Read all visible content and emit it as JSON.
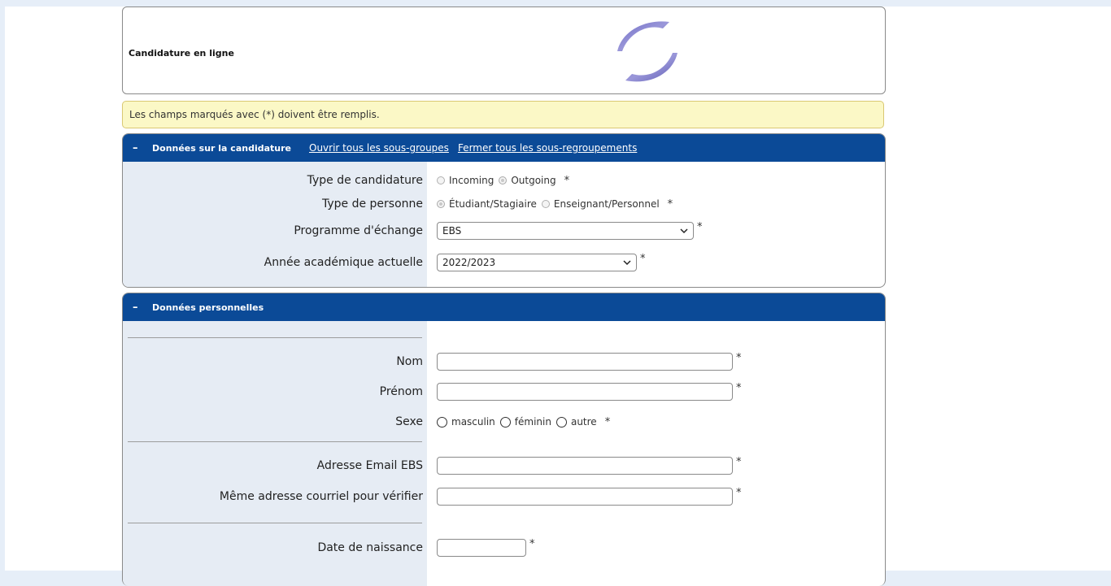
{
  "header": {
    "title": "Candidature en ligne"
  },
  "notice": "Les champs marqués avec (*) doivent être remplis.",
  "section1": {
    "collapse": "–",
    "title": "Données sur la candidature",
    "link_open": "Ouvrir tous les sous-groupes",
    "link_close": "Fermer tous les sous-regroupements",
    "type_candidature": {
      "label": "Type de candidature",
      "options": [
        "Incoming",
        "Outgoing"
      ],
      "selected": "Outgoing"
    },
    "type_personne": {
      "label": "Type de personne",
      "options": [
        "Étudiant/Stagiaire",
        "Enseignant/Personnel"
      ],
      "selected": "Étudiant/Stagiaire"
    },
    "programme": {
      "label": "Programme d'échange",
      "value": "EBS"
    },
    "annee": {
      "label": "Année académique actuelle",
      "value": "2022/2023"
    }
  },
  "section2": {
    "collapse": "–",
    "title": "Données personnelles",
    "nom": {
      "label": "Nom",
      "value": ""
    },
    "prenom": {
      "label": "Prénom",
      "value": ""
    },
    "sexe": {
      "label": "Sexe",
      "options": [
        "masculin",
        "féminin",
        "autre"
      ]
    },
    "email": {
      "label": "Adresse Email EBS",
      "value": ""
    },
    "email_confirm": {
      "label": "Même adresse courriel pour vérifier",
      "value": ""
    },
    "naissance": {
      "label": "Date de naissance",
      "value": ""
    }
  },
  "required_mark": "*",
  "colors": {
    "header_blue": "#0b4a97",
    "notice_bg": "#fbf8c6",
    "label_bg": "#e6ecf4"
  }
}
